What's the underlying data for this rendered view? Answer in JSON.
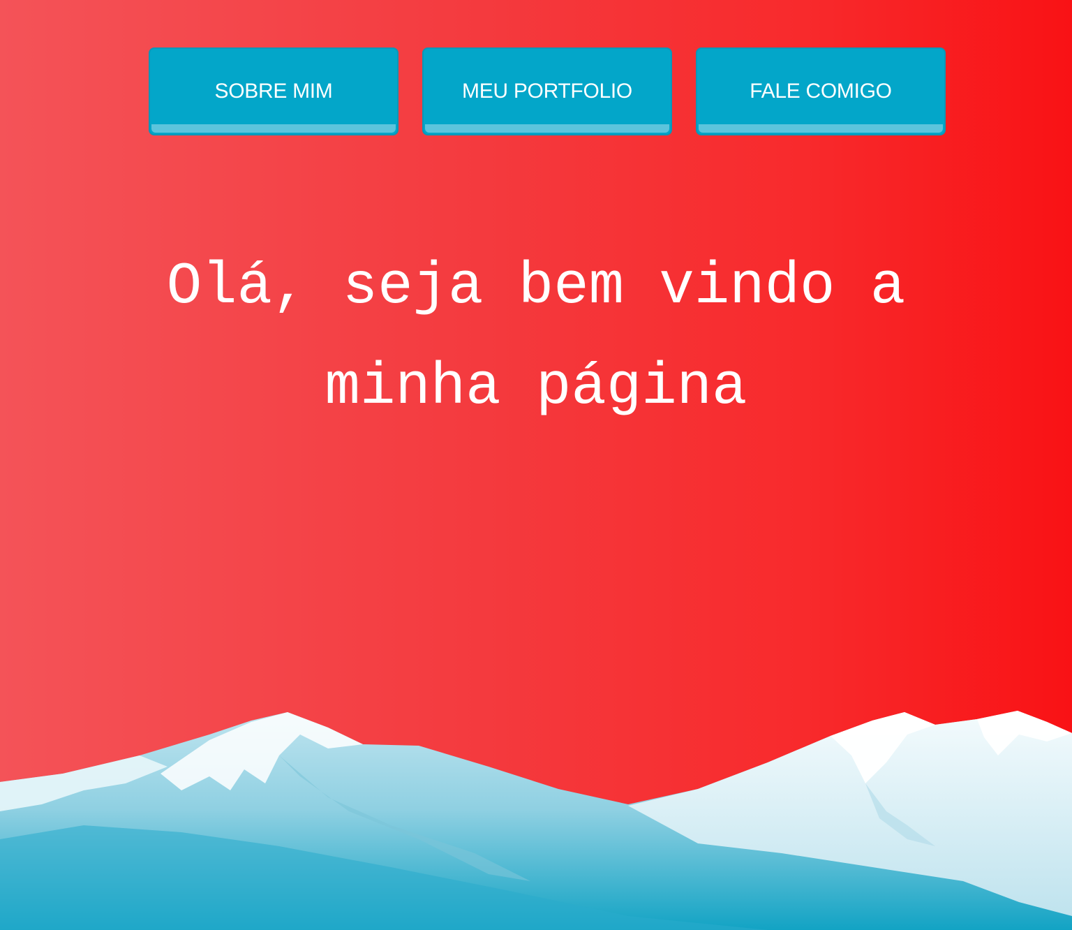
{
  "nav": {
    "items": [
      {
        "label": "SOBRE MIM"
      },
      {
        "label": "MEU PORTFOLIO"
      },
      {
        "label": "FALE COMIGO"
      }
    ]
  },
  "hero": {
    "line1": "Olá, seja bem vindo a",
    "line2": "minha página"
  },
  "colors": {
    "background_start": "#f45358",
    "background_end": "#f91215",
    "button": "#03a6c9",
    "button_lip": "#5cc4dc",
    "text": "#ffffff"
  },
  "decoration": {
    "icon": "snowy-mountains-icon"
  }
}
